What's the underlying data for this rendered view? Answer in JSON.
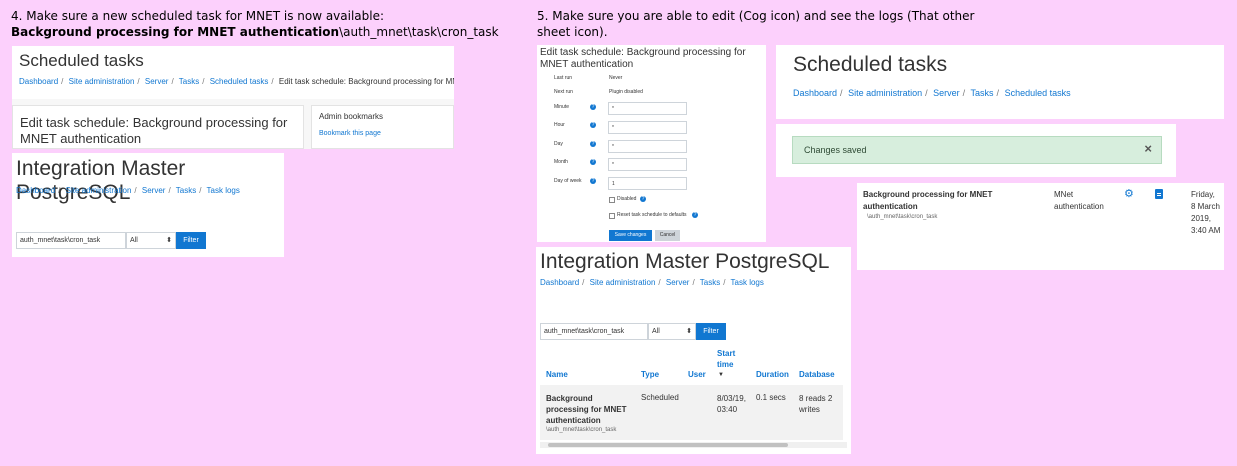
{
  "notes": {
    "step4_line1": "4. Make sure a new scheduled task for MNET is now available:",
    "step4_bold": "Background processing for MNET authentication",
    "step4_tail": "\\auth_mnet\\task\\cron_task",
    "step5_line1": "5. Make sure you are able to edit (Cog icon) and see the logs (That other",
    "step5_line2": "sheet icon)."
  },
  "panel_a": {
    "title": "Scheduled tasks",
    "breadcrumb": [
      "Dashboard",
      "Site administration",
      "Server",
      "Tasks",
      "Scheduled tasks"
    ],
    "breadcrumb_current": "Edit task schedule: Background processing for MNET authentication",
    "heading": "Edit task schedule: Background processing for MNET authentication",
    "block_title": "Admin bookmarks",
    "block_link": "Bookmark this page"
  },
  "panel_b": {
    "title": "Integration Master PostgreSQL",
    "breadcrumb": [
      "Dashboard",
      "Site administration",
      "Server",
      "Tasks",
      "Task logs"
    ],
    "filter_value": "auth_mnet\\task\\cron_task",
    "select_value": "All",
    "filter_button": "Filter"
  },
  "panel_c": {
    "heading": "Edit task schedule: Background processing for MNET authentication",
    "last_run_label": "Last run",
    "last_run_value": "Never",
    "next_run_label": "Next run",
    "next_run_value": "Plugin disabled",
    "fields": [
      {
        "label": "Minute",
        "value": "*"
      },
      {
        "label": "Hour",
        "value": "*"
      },
      {
        "label": "Day",
        "value": "*"
      },
      {
        "label": "Month",
        "value": "*"
      },
      {
        "label": "Day of week",
        "value": "1"
      }
    ],
    "disabled_label": "Disabled",
    "reset_label": "Reset task schedule to defaults",
    "save_button": "Save changes",
    "cancel_button": "Cancel"
  },
  "panel_d": {
    "title": "Integration Master PostgreSQL",
    "breadcrumb": [
      "Dashboard",
      "Site administration",
      "Server",
      "Tasks",
      "Task logs"
    ],
    "filter_value": "auth_mnet\\task\\cron_task",
    "select_value": "All",
    "filter_button": "Filter",
    "columns": [
      "Name",
      "Type",
      "User",
      "Start time",
      "Duration",
      "Database"
    ],
    "row": {
      "name": "Background processing for MNET authentication",
      "name_sub": "\\auth_mnet\\task\\cron_task",
      "type": "Scheduled",
      "user": "",
      "start_time": "8/03/19, 03:40",
      "duration": "0.1 secs",
      "database": "8 reads 2 writes"
    }
  },
  "panel_e": {
    "title": "Scheduled tasks",
    "breadcrumb": [
      "Dashboard",
      "Site administration",
      "Server",
      "Tasks",
      "Scheduled tasks"
    ]
  },
  "panel_f": {
    "alert": "Changes saved",
    "close_glyph": "×"
  },
  "panel_g": {
    "name": "Background processing for MNET authentication",
    "name_sub": "\\auth_mnet\\task\\cron_task",
    "component": "MNet authentication",
    "date": "Friday, 8 March 2019, 3:40 AM"
  }
}
